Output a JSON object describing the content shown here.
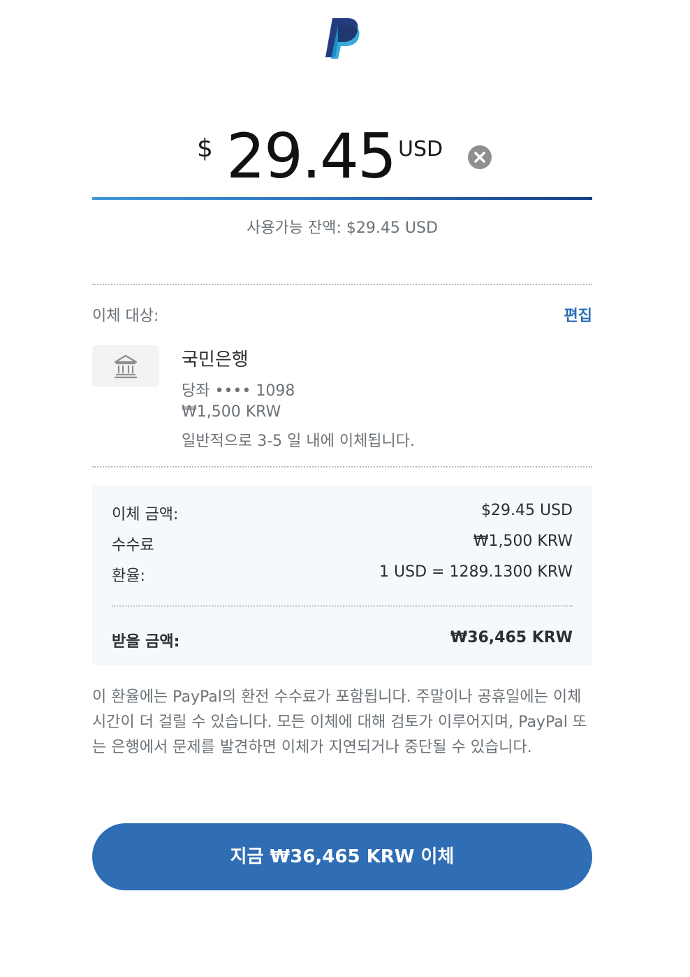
{
  "brand": {
    "logo_icon": "paypal-logo-icon",
    "colors": {
      "dark": "#253b80",
      "light": "#179bd7",
      "accent": "#2f6db5"
    }
  },
  "amount": {
    "symbol": "$",
    "value": "29.45",
    "currency": "USD",
    "clear_icon": "clear-circle-icon"
  },
  "balance": "사용가능 잔액: $29.45 USD",
  "destination": {
    "label": "이체 대상:",
    "edit_label": "편집",
    "bank_icon": "bank-icon",
    "bank_name": "국민은행",
    "account": "당좌 •••• 1098",
    "fee": "₩1,500 KRW",
    "timing": "일반적으로 3-5 일 내에 이체됩니다."
  },
  "summary": {
    "rows": [
      {
        "label": "이체 금액:",
        "value": "$29.45 USD"
      },
      {
        "label": "수수료",
        "value": "₩1,500 KRW"
      },
      {
        "label": "환율:",
        "value": "1 USD = 1289.1300 KRW"
      }
    ],
    "total": {
      "label": "받을 금액:",
      "value": "₩36,465 KRW"
    }
  },
  "disclaimer": "이 환율에는 PayPal의 환전 수수료가 포함됩니다. 주말이나 공휴일에는 이체 시간이 더 걸릴 수 있습니다. 모든 이체에 대해 검토가 이루어지며, PayPal 또는 은행에서 문제를 발견하면 이체가 지연되거나 중단될 수 있습니다.",
  "transfer_button": "지금 ₩36,465 KRW 이체"
}
